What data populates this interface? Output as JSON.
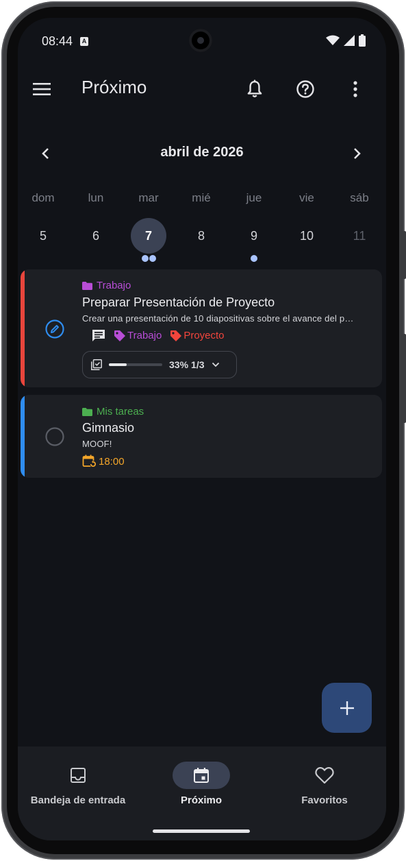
{
  "status_bar": {
    "time": "08:44",
    "badge": "A"
  },
  "app_bar": {
    "title": "Próximo",
    "menu_icon": "menu-icon",
    "bell_icon": "bell-icon",
    "help_icon": "help-icon",
    "more_icon": "more-vert-icon"
  },
  "calendar": {
    "month_label": "abril de 2026",
    "days": [
      {
        "name": "dom",
        "num": "5",
        "dots": 0,
        "state": "normal"
      },
      {
        "name": "lun",
        "num": "6",
        "dots": 0,
        "state": "normal"
      },
      {
        "name": "mar",
        "num": "7",
        "dots": 2,
        "state": "selected"
      },
      {
        "name": "mié",
        "num": "8",
        "dots": 0,
        "state": "normal"
      },
      {
        "name": "jue",
        "num": "9",
        "dots": 1,
        "state": "normal"
      },
      {
        "name": "vie",
        "num": "10",
        "dots": 0,
        "state": "normal"
      },
      {
        "name": "sáb",
        "num": "11",
        "dots": 0,
        "state": "faded"
      }
    ]
  },
  "tasks": [
    {
      "project": "Trabajo",
      "project_color": "#b84dd6",
      "accent_color": "#e8453c",
      "title": "Preparar Presentación de Proyecto",
      "description": "Crear una presentación de 10 diapositivas sobre el avance del proyecto",
      "tags": [
        {
          "label": "Trabajo",
          "color": "#b84dd6"
        },
        {
          "label": "Proyecto",
          "color": "#f2453c"
        }
      ],
      "subtasks": {
        "percent_label": "33%",
        "count_label": "1/3",
        "progress": 0.33
      }
    },
    {
      "project": "Mis tareas",
      "project_color": "#4caf50",
      "accent_color": "#2f8df0",
      "title": "Gimnasio",
      "description": "MOOF!",
      "time": "18:00",
      "time_color": "#f4a62a"
    }
  ],
  "fab": {
    "icon": "plus-icon"
  },
  "bottom_nav": {
    "items": [
      {
        "label": "Bandeja de entrada",
        "icon": "inbox-icon",
        "active": false
      },
      {
        "label": "Próximo",
        "icon": "calendar-icon",
        "active": true
      },
      {
        "label": "Favoritos",
        "icon": "heart-icon",
        "active": false
      }
    ]
  }
}
